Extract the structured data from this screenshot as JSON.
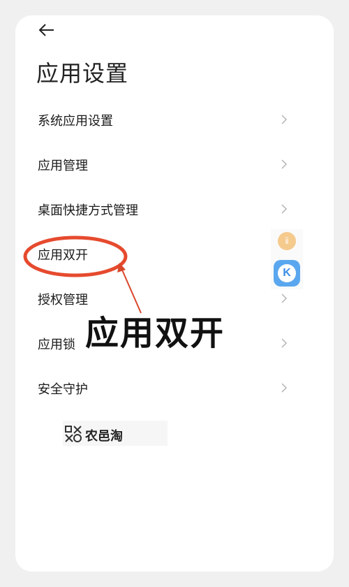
{
  "header": {
    "back_icon": "arrow-left-icon",
    "title": "应用设置"
  },
  "menu": {
    "items": [
      {
        "label": "系统应用设置",
        "icon": "chevron-right-icon"
      },
      {
        "label": "应用管理",
        "icon": "chevron-right-icon"
      },
      {
        "label": "桌面快捷方式管理",
        "icon": "chevron-right-icon"
      },
      {
        "label": "应用双开",
        "icon": "chevron-right-icon"
      },
      {
        "label": "授权管理",
        "icon": "chevron-right-icon"
      },
      {
        "label": "应用锁",
        "icon": "chevron-right-icon"
      },
      {
        "label": "安全守护",
        "icon": "chevron-right-icon"
      }
    ]
  },
  "annotation": {
    "text": "应用双开",
    "highlight_color": "#e64a2e",
    "arrow_color": "#d9472b"
  },
  "floating_badges": {
    "orange_symbol": "ⅱ",
    "k_letter": "K",
    "k_color": "#5aa7ef"
  },
  "watermark": {
    "text": "农邑淘",
    "icon": "qr-style-icon"
  }
}
